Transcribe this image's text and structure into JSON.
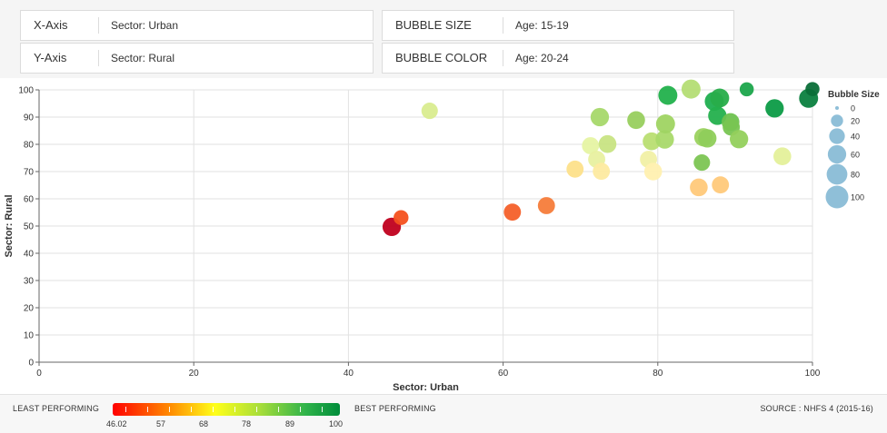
{
  "controls": {
    "x_axis": {
      "label": "X-Axis",
      "value": "Sector: Urban"
    },
    "y_axis": {
      "label": "Y-Axis",
      "value": "Sector: Rural"
    },
    "bubble_size": {
      "label": "BUBBLE SIZE",
      "value": "Age: 15-19"
    },
    "bubble_color": {
      "label": "BUBBLE COLOR",
      "value": "Age: 20-24"
    }
  },
  "footer": {
    "least": "LEAST PERFORMING",
    "best": "BEST PERFORMING",
    "source": "SOURCE : NHFS 4 (2015-16)",
    "gradient_labels": [
      "46.02",
      "57",
      "68",
      "78",
      "89",
      "100"
    ]
  },
  "chart_data": {
    "type": "scatter",
    "xlabel": "Sector: Urban",
    "ylabel": "Sector: Rural",
    "xlim": [
      0,
      100
    ],
    "ylim": [
      0,
      100
    ],
    "xticks": [
      0,
      20,
      40,
      60,
      80,
      100
    ],
    "yticks": [
      0,
      10,
      20,
      30,
      40,
      50,
      60,
      70,
      80,
      90,
      100
    ],
    "grid": true,
    "legend": {
      "title": "Bubble Size",
      "sizes": [
        0,
        20,
        40,
        60,
        80,
        100
      ],
      "placement": "right"
    },
    "colors": {
      "low": "#ff0000",
      "mid": "#ffff1a",
      "high": "#008c3a"
    },
    "points": [
      {
        "x": 45.6,
        "y": 49.7,
        "size": 60,
        "color": "#c0001e"
      },
      {
        "x": 46.8,
        "y": 53.1,
        "size": 35,
        "color": "#f4511e"
      },
      {
        "x": 50.5,
        "y": 92.3,
        "size": 45,
        "color": "#d9ec8f"
      },
      {
        "x": 61.2,
        "y": 55.1,
        "size": 50,
        "color": "#f4602a"
      },
      {
        "x": 65.6,
        "y": 57.5,
        "size": 50,
        "color": "#f57c3a"
      },
      {
        "x": 69.3,
        "y": 70.9,
        "size": 50,
        "color": "#fde08a"
      },
      {
        "x": 71.3,
        "y": 79.5,
        "size": 50,
        "color": "#e6f4a3"
      },
      {
        "x": 72.1,
        "y": 74.5,
        "size": 50,
        "color": "#e8f0a0"
      },
      {
        "x": 72.5,
        "y": 90.0,
        "size": 60,
        "color": "#a6d86a"
      },
      {
        "x": 72.7,
        "y": 70.1,
        "size": 50,
        "color": "#fdeaa0"
      },
      {
        "x": 73.5,
        "y": 80.1,
        "size": 55,
        "color": "#c8e483"
      },
      {
        "x": 77.2,
        "y": 88.9,
        "size": 55,
        "color": "#98cf5e"
      },
      {
        "x": 78.8,
        "y": 74.5,
        "size": 50,
        "color": "#f1f0a5"
      },
      {
        "x": 79.2,
        "y": 81.1,
        "size": 55,
        "color": "#b9de72"
      },
      {
        "x": 79.4,
        "y": 70.0,
        "size": 55,
        "color": "#fff0b0"
      },
      {
        "x": 80.9,
        "y": 81.8,
        "size": 60,
        "color": "#a9d96a"
      },
      {
        "x": 81.0,
        "y": 87.5,
        "size": 65,
        "color": "#9fd462"
      },
      {
        "x": 81.3,
        "y": 98.0,
        "size": 65,
        "color": "#22b14c"
      },
      {
        "x": 84.3,
        "y": 100.3,
        "size": 65,
        "color": "#b4dd74"
      },
      {
        "x": 85.3,
        "y": 64.2,
        "size": 55,
        "color": "#ffc97a"
      },
      {
        "x": 85.7,
        "y": 73.3,
        "size": 45,
        "color": "#7cc553"
      },
      {
        "x": 85.9,
        "y": 82.6,
        "size": 60,
        "color": "#9bd25f"
      },
      {
        "x": 86.4,
        "y": 82.2,
        "size": 60,
        "color": "#8fcd5b"
      },
      {
        "x": 87.3,
        "y": 95.8,
        "size": 65,
        "color": "#1fae4f"
      },
      {
        "x": 87.7,
        "y": 90.5,
        "size": 60,
        "color": "#24b04d"
      },
      {
        "x": 88.0,
        "y": 97.0,
        "size": 65,
        "color": "#28ad4a"
      },
      {
        "x": 88.1,
        "y": 65.1,
        "size": 50,
        "color": "#ffc97a"
      },
      {
        "x": 89.4,
        "y": 88.2,
        "size": 55,
        "color": "#6ec24f"
      },
      {
        "x": 89.5,
        "y": 86.3,
        "size": 50,
        "color": "#78c552"
      },
      {
        "x": 90.5,
        "y": 81.9,
        "size": 60,
        "color": "#93d05c"
      },
      {
        "x": 91.5,
        "y": 100.2,
        "size": 30,
        "color": "#1ba54b"
      },
      {
        "x": 95.1,
        "y": 93.2,
        "size": 60,
        "color": "#0c9b46"
      },
      {
        "x": 96.1,
        "y": 75.6,
        "size": 55,
        "color": "#e4f09a"
      },
      {
        "x": 99.5,
        "y": 96.9,
        "size": 65,
        "color": "#0b7f3f"
      },
      {
        "x": 100.0,
        "y": 100.3,
        "size": 30,
        "color": "#0a6e38"
      }
    ]
  }
}
